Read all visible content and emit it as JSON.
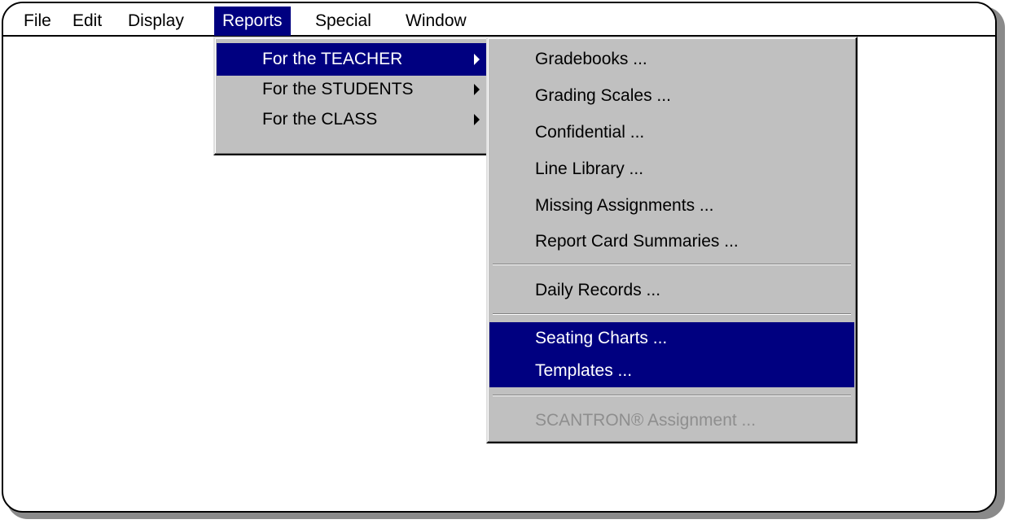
{
  "menubar": {
    "items": [
      "File",
      "Edit",
      "Display",
      "Reports",
      "Special",
      "Window"
    ],
    "active": "Reports"
  },
  "reports_menu": {
    "items": [
      {
        "label": "For the TEACHER",
        "submenu": true,
        "highlighted": true
      },
      {
        "label": "For the STUDENTS",
        "submenu": true,
        "highlighted": false
      },
      {
        "label": "For the CLASS",
        "submenu": true,
        "highlighted": false
      }
    ]
  },
  "teacher_submenu": {
    "items": [
      {
        "label": "Gradebooks ..."
      },
      {
        "label": "Grading Scales ..."
      },
      {
        "label": "Confidential ..."
      },
      {
        "label": "Line Library ..."
      },
      {
        "label": "Missing Assignments ..."
      },
      {
        "label": "Report Card Summaries ..."
      },
      {
        "label": "Daily Records ..."
      },
      {
        "label": "Seating Charts ...",
        "highlighted": true
      },
      {
        "label": "Templates ...",
        "highlighted": true
      },
      {
        "label": "SCANTRON® Assignment ...",
        "disabled": true
      }
    ]
  },
  "colors": {
    "highlight": "#000080",
    "menu_face": "#c0c0c0",
    "disabled_text": "#8e8e8e"
  }
}
